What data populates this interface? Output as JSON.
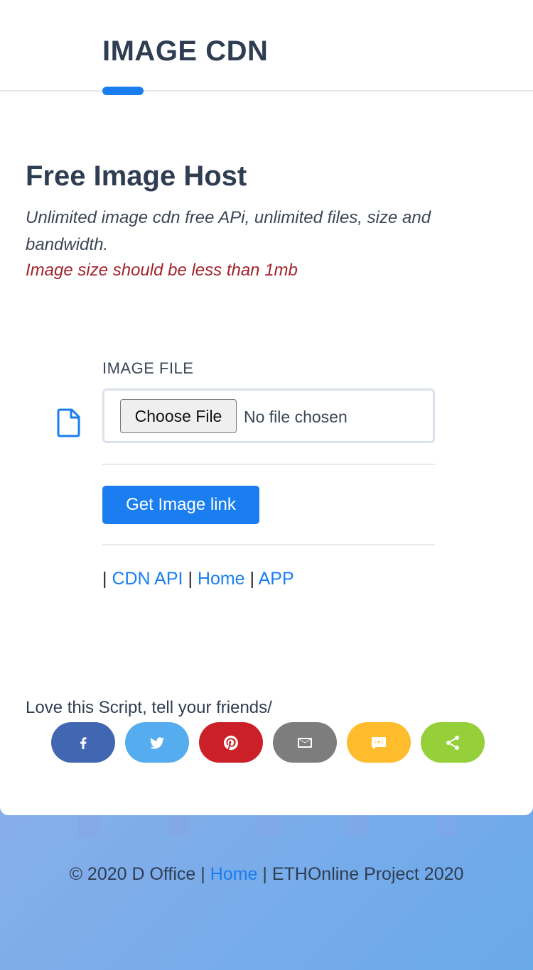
{
  "header": {
    "brand": "IMAGE CDN"
  },
  "hero": {
    "title": "Free Image Host",
    "subtitle": "Unlimited image cdn free APi, unlimited files, size and bandwidth.",
    "warning": "Image size should be less than 1mb"
  },
  "form": {
    "field_label": "IMAGE FILE",
    "choose_file_label": "Choose File",
    "no_file_text": "No file chosen",
    "submit_label": "Get Image link"
  },
  "links": {
    "separator": "|",
    "items": [
      "CDN API",
      "Home",
      "APP"
    ]
  },
  "share": {
    "text": "Love this Script, tell your friends/",
    "buttons": [
      {
        "name": "facebook",
        "icon": "facebook-icon",
        "color": "#4267b2"
      },
      {
        "name": "twitter",
        "icon": "twitter-icon",
        "color": "#55acee"
      },
      {
        "name": "pinterest",
        "icon": "pinterest-icon",
        "color": "#cb2027"
      },
      {
        "name": "email",
        "icon": "email-icon",
        "color": "#7d7d7d"
      },
      {
        "name": "sms",
        "icon": "sms-icon",
        "color": "#ffbd2e"
      },
      {
        "name": "share",
        "icon": "share-icon",
        "color": "#95d03a"
      }
    ]
  },
  "footer": {
    "copyright": "© 2020 D Office",
    "separator": "|",
    "home_link": "Home",
    "project": "ETHOnline Project 2020"
  },
  "colors": {
    "accent": "#1a7ef0",
    "heading": "#2f3d52",
    "warning": "#a4232c"
  }
}
